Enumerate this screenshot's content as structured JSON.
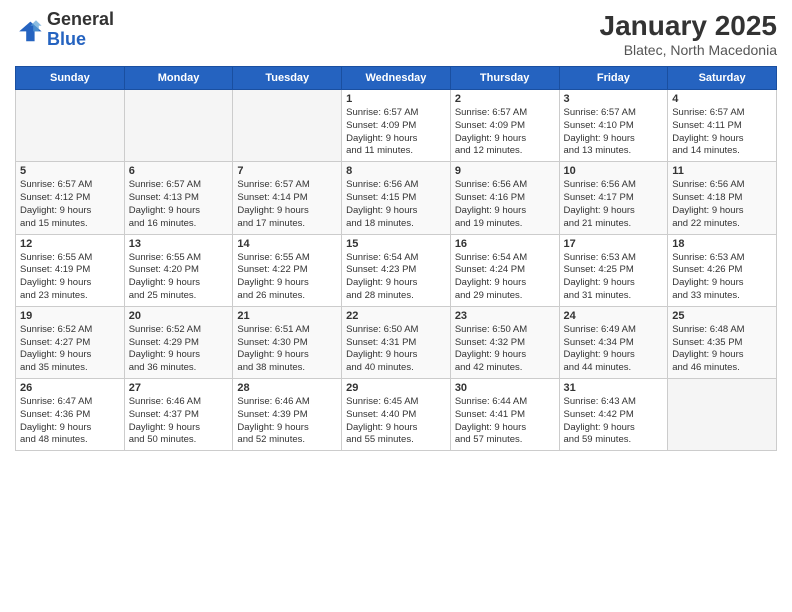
{
  "header": {
    "logo_general": "General",
    "logo_blue": "Blue",
    "month_title": "January 2025",
    "subtitle": "Blatec, North Macedonia"
  },
  "weekdays": [
    "Sunday",
    "Monday",
    "Tuesday",
    "Wednesday",
    "Thursday",
    "Friday",
    "Saturday"
  ],
  "weeks": [
    [
      {
        "day": "",
        "info": ""
      },
      {
        "day": "",
        "info": ""
      },
      {
        "day": "",
        "info": ""
      },
      {
        "day": "1",
        "info": "Sunrise: 6:57 AM\nSunset: 4:09 PM\nDaylight: 9 hours\nand 11 minutes."
      },
      {
        "day": "2",
        "info": "Sunrise: 6:57 AM\nSunset: 4:09 PM\nDaylight: 9 hours\nand 12 minutes."
      },
      {
        "day": "3",
        "info": "Sunrise: 6:57 AM\nSunset: 4:10 PM\nDaylight: 9 hours\nand 13 minutes."
      },
      {
        "day": "4",
        "info": "Sunrise: 6:57 AM\nSunset: 4:11 PM\nDaylight: 9 hours\nand 14 minutes."
      }
    ],
    [
      {
        "day": "5",
        "info": "Sunrise: 6:57 AM\nSunset: 4:12 PM\nDaylight: 9 hours\nand 15 minutes."
      },
      {
        "day": "6",
        "info": "Sunrise: 6:57 AM\nSunset: 4:13 PM\nDaylight: 9 hours\nand 16 minutes."
      },
      {
        "day": "7",
        "info": "Sunrise: 6:57 AM\nSunset: 4:14 PM\nDaylight: 9 hours\nand 17 minutes."
      },
      {
        "day": "8",
        "info": "Sunrise: 6:56 AM\nSunset: 4:15 PM\nDaylight: 9 hours\nand 18 minutes."
      },
      {
        "day": "9",
        "info": "Sunrise: 6:56 AM\nSunset: 4:16 PM\nDaylight: 9 hours\nand 19 minutes."
      },
      {
        "day": "10",
        "info": "Sunrise: 6:56 AM\nSunset: 4:17 PM\nDaylight: 9 hours\nand 21 minutes."
      },
      {
        "day": "11",
        "info": "Sunrise: 6:56 AM\nSunset: 4:18 PM\nDaylight: 9 hours\nand 22 minutes."
      }
    ],
    [
      {
        "day": "12",
        "info": "Sunrise: 6:55 AM\nSunset: 4:19 PM\nDaylight: 9 hours\nand 23 minutes."
      },
      {
        "day": "13",
        "info": "Sunrise: 6:55 AM\nSunset: 4:20 PM\nDaylight: 9 hours\nand 25 minutes."
      },
      {
        "day": "14",
        "info": "Sunrise: 6:55 AM\nSunset: 4:22 PM\nDaylight: 9 hours\nand 26 minutes."
      },
      {
        "day": "15",
        "info": "Sunrise: 6:54 AM\nSunset: 4:23 PM\nDaylight: 9 hours\nand 28 minutes."
      },
      {
        "day": "16",
        "info": "Sunrise: 6:54 AM\nSunset: 4:24 PM\nDaylight: 9 hours\nand 29 minutes."
      },
      {
        "day": "17",
        "info": "Sunrise: 6:53 AM\nSunset: 4:25 PM\nDaylight: 9 hours\nand 31 minutes."
      },
      {
        "day": "18",
        "info": "Sunrise: 6:53 AM\nSunset: 4:26 PM\nDaylight: 9 hours\nand 33 minutes."
      }
    ],
    [
      {
        "day": "19",
        "info": "Sunrise: 6:52 AM\nSunset: 4:27 PM\nDaylight: 9 hours\nand 35 minutes."
      },
      {
        "day": "20",
        "info": "Sunrise: 6:52 AM\nSunset: 4:29 PM\nDaylight: 9 hours\nand 36 minutes."
      },
      {
        "day": "21",
        "info": "Sunrise: 6:51 AM\nSunset: 4:30 PM\nDaylight: 9 hours\nand 38 minutes."
      },
      {
        "day": "22",
        "info": "Sunrise: 6:50 AM\nSunset: 4:31 PM\nDaylight: 9 hours\nand 40 minutes."
      },
      {
        "day": "23",
        "info": "Sunrise: 6:50 AM\nSunset: 4:32 PM\nDaylight: 9 hours\nand 42 minutes."
      },
      {
        "day": "24",
        "info": "Sunrise: 6:49 AM\nSunset: 4:34 PM\nDaylight: 9 hours\nand 44 minutes."
      },
      {
        "day": "25",
        "info": "Sunrise: 6:48 AM\nSunset: 4:35 PM\nDaylight: 9 hours\nand 46 minutes."
      }
    ],
    [
      {
        "day": "26",
        "info": "Sunrise: 6:47 AM\nSunset: 4:36 PM\nDaylight: 9 hours\nand 48 minutes."
      },
      {
        "day": "27",
        "info": "Sunrise: 6:46 AM\nSunset: 4:37 PM\nDaylight: 9 hours\nand 50 minutes."
      },
      {
        "day": "28",
        "info": "Sunrise: 6:46 AM\nSunset: 4:39 PM\nDaylight: 9 hours\nand 52 minutes."
      },
      {
        "day": "29",
        "info": "Sunrise: 6:45 AM\nSunset: 4:40 PM\nDaylight: 9 hours\nand 55 minutes."
      },
      {
        "day": "30",
        "info": "Sunrise: 6:44 AM\nSunset: 4:41 PM\nDaylight: 9 hours\nand 57 minutes."
      },
      {
        "day": "31",
        "info": "Sunrise: 6:43 AM\nSunset: 4:42 PM\nDaylight: 9 hours\nand 59 minutes."
      },
      {
        "day": "",
        "info": ""
      }
    ]
  ]
}
